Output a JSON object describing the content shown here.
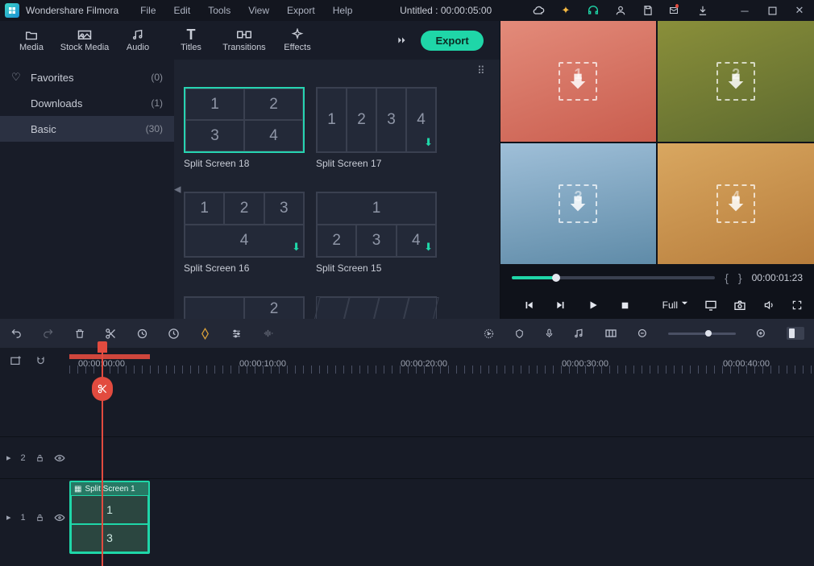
{
  "app_name": "Wondershare Filmora",
  "menu": [
    "File",
    "Edit",
    "Tools",
    "View",
    "Export",
    "Help"
  ],
  "title_center": "Untitled : 00:00:05:00",
  "export_btn": "Export",
  "tabs": [
    {
      "id": "media",
      "label": "Media"
    },
    {
      "id": "stock",
      "label": "Stock Media"
    },
    {
      "id": "audio",
      "label": "Audio"
    },
    {
      "id": "titles",
      "label": "Titles"
    },
    {
      "id": "transitions",
      "label": "Transitions"
    },
    {
      "id": "effects",
      "label": "Effects"
    }
  ],
  "sidebar": [
    {
      "label": "Favorites",
      "count": "(0)",
      "heart": true,
      "selected": false
    },
    {
      "label": "Downloads",
      "count": "(1)",
      "heart": false,
      "selected": false
    },
    {
      "label": "Basic",
      "count": "(30)",
      "heart": false,
      "selected": true
    }
  ],
  "thumbs": [
    {
      "label": "Split Screen 18",
      "cells": [
        "1",
        "2",
        "3",
        "4"
      ],
      "layout": "g22",
      "selected": true,
      "dl": false
    },
    {
      "label": "Split Screen 17",
      "cells": [
        "1",
        "2",
        "3",
        "4"
      ],
      "layout": "row4",
      "selected": false,
      "dl": true
    },
    {
      "label": "Split Screen 16",
      "cells": [
        "1",
        "2",
        "3",
        "4"
      ],
      "layout": "top3bot1",
      "selected": false,
      "dl": true
    },
    {
      "label": "Split Screen 15",
      "cells": [
        "1",
        "2",
        "3",
        "4"
      ],
      "layout": "top1bot3",
      "selected": false,
      "dl": true
    },
    {
      "label": "",
      "cells": [
        "",
        "2",
        "",
        ""
      ],
      "layout": "g22b",
      "selected": false,
      "dl": false
    },
    {
      "label": "",
      "cells": [
        "",
        "",
        "",
        ""
      ],
      "layout": "diag",
      "selected": false,
      "dl": false
    }
  ],
  "preview": {
    "nums": [
      "1",
      "2",
      "3",
      "4"
    ],
    "timecode": "00:00:01:23",
    "quality": "Full"
  },
  "ruler": {
    "labels": [
      "00:00:00:00",
      "00:00:10:00",
      "00:00:20:00",
      "00:00:30:00",
      "00:00:40:00"
    ]
  },
  "tracks": {
    "t2": "2",
    "t1": "1"
  },
  "clip": {
    "title": "Split Screen 1",
    "cells": [
      "1",
      "3"
    ]
  },
  "colors": {
    "accent": "#1fd6a8",
    "playhead": "#e24b3f"
  }
}
